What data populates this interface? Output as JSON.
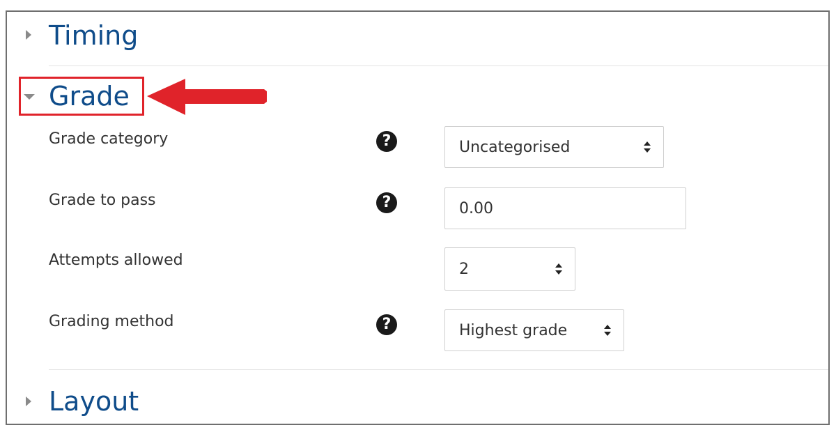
{
  "sections": {
    "timing": {
      "title": "Timing",
      "expanded": false
    },
    "grade": {
      "title": "Grade",
      "expanded": true
    },
    "layout": {
      "title": "Layout",
      "expanded": false
    }
  },
  "grade_fields": {
    "grade_category": {
      "label": "Grade category",
      "value": "Uncategorised",
      "type": "select",
      "help_icon": "question-circle-icon"
    },
    "grade_to_pass": {
      "label": "Grade to pass",
      "value": "0.00",
      "type": "text",
      "help_icon": "question-circle-icon"
    },
    "attempts_allowed": {
      "label": "Attempts allowed",
      "value": "2",
      "type": "select"
    },
    "grading_method": {
      "label": "Grading method",
      "value": "Highest grade",
      "type": "select",
      "help_icon": "question-circle-icon"
    }
  },
  "colors": {
    "section_title": "#0f4c8a",
    "annotation_red": "#e0232a",
    "help_icon_bg": "#1a1a1a"
  },
  "icons": {
    "collapsed_caret": "caret-right-icon",
    "expanded_caret": "caret-down-icon",
    "help": "question-circle-icon",
    "select": "select-updown-icon"
  }
}
